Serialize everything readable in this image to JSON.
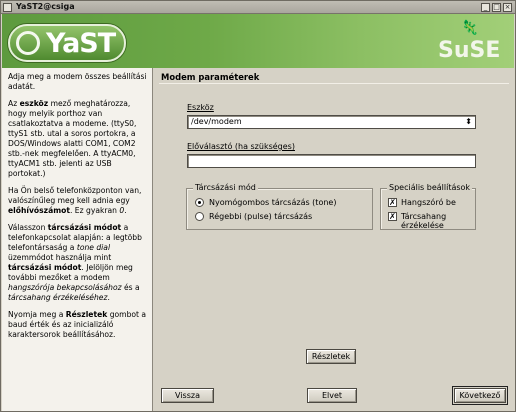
{
  "window": {
    "title": "YaST2@csiga",
    "minimize": "_",
    "maximize": "□",
    "close": "×"
  },
  "brand": {
    "yast": "YaST",
    "suse": "SuSE",
    "geeko": "🦎"
  },
  "help": {
    "p1": "Adja meg a modem összes beállítási adatát.",
    "p2a": "Az ",
    "p2b": "eszköz",
    "p2c": " mező meghatározza, hogy melyik porthoz van csatlakoztatva a modeme. (ttyS0, ttyS1 stb. utal a soros portokra, a DOS/Windows alatti COM1, COM2 stb.-nek megfelelően. A ttyACM0, ttyACM1 stb. jelenti az USB portokat.)",
    "p3a": "Ha Ön belső telefonközponton van, valószínűleg meg kell adnia egy ",
    "p3b": "előhívószámot",
    "p3c": ". Ez gyakran ",
    "p3d": "0",
    "p3e": ".",
    "p4a": "Válasszon ",
    "p4b": "tárcsázási módot",
    "p4c": " a telefonkapcsolat alapján: a legtöbb telefontársaság a ",
    "p4d": "tone dial",
    "p4e": " üzemmódot használja mint ",
    "p4f": "tárcsázási módot",
    "p4g": ". Jelöljön meg további mezőket a modem ",
    "p4h": "hangszórója bekapcsolásához",
    "p4i": " és a ",
    "p4j": "tárcsahang érzékeléséhez",
    "p4k": ".",
    "p5a": "Nyomja meg a ",
    "p5b": "Részletek",
    "p5c": " gombot a baud érték és az inicializáló karaktersorok beállításához."
  },
  "main": {
    "title": "Modem paraméterek",
    "device_label": "Eszköz",
    "device_value": "/dev/modem",
    "device_arrow": "⬍",
    "prefix_label": "Előválasztó (ha szükséges)",
    "prefix_value": "",
    "dial_mode": {
      "title": "Tárcsázási mód",
      "tone": "Nyomógombos tárcsázás (tone)",
      "pulse": "Régebbi (pulse) tárcsázás",
      "selected": "tone"
    },
    "special": {
      "title": "Speciális beállítások",
      "speaker": "Hangszóró be",
      "speaker_checked": true,
      "detect": "Tárcsahang érzékelése",
      "detect_checked": true,
      "check_glyph": "✗"
    },
    "details_button": "Részletek"
  },
  "buttons": {
    "back": "Vissza",
    "abort": "Elvet",
    "next": "Következő"
  }
}
